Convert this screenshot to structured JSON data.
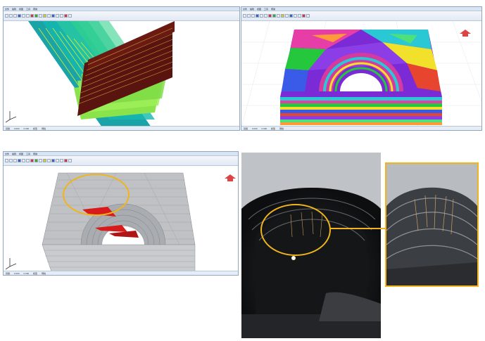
{
  "app": {
    "menu_items": [
      "文件",
      "编辑",
      "视图",
      "工具",
      "帮助"
    ],
    "status_items": [
      "就绪",
      "0.000",
      "0.000",
      "模型",
      "网格"
    ]
  },
  "windows": [
    {
      "id": "discontinuity-sets",
      "view": "fracture-planes"
    },
    {
      "id": "block-model-colored",
      "view": "tunnel-blocks-colored"
    },
    {
      "id": "block-model-gray",
      "view": "tunnel-blocks-removable"
    }
  ],
  "photos": {
    "tunnel": {
      "label": ""
    },
    "zoom": {
      "label": ""
    }
  },
  "colors": {
    "highlight": "#f0b41c",
    "window_border": "#8fa7c4",
    "toolbar_bg": "#e2eaf4",
    "removable_block": "#d81a1a"
  },
  "icons": {
    "axis": "axis-triad-icon",
    "orientation": "compass-icon"
  }
}
